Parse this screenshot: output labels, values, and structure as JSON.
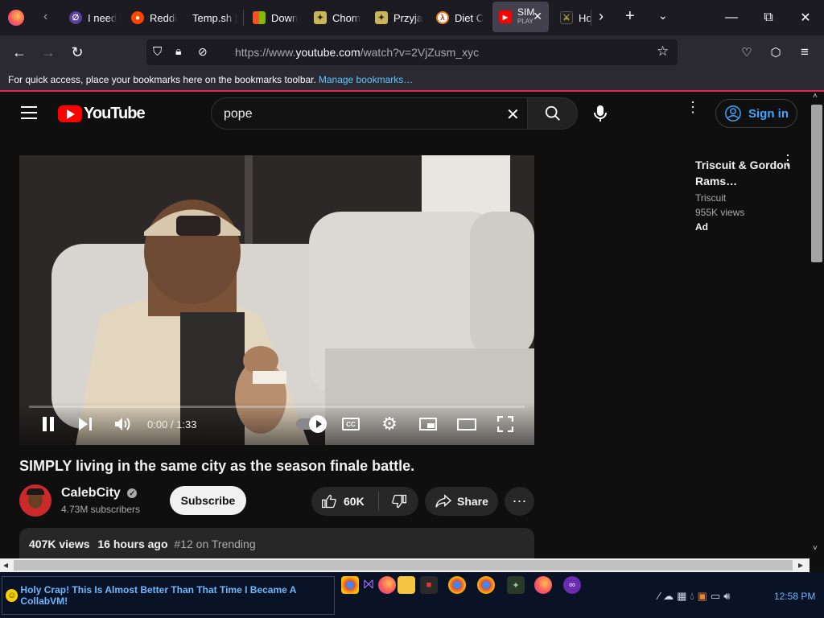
{
  "browser": {
    "tabs": [
      {
        "title": "I need"
      },
      {
        "title": "Reddi"
      },
      {
        "title": "Temp.sh |"
      },
      {
        "title": "Down"
      },
      {
        "title": "Chom"
      },
      {
        "title": "Przyja"
      },
      {
        "title": "Diet C"
      },
      {
        "title": "SIM",
        "subtitle": "PLAY",
        "active": true
      },
      {
        "title": "Ho"
      }
    ],
    "url_base": "https://www.",
    "url_host": "youtube.com",
    "url_path": "/watch?v=2VjZusm_xyc",
    "bookmarks_hint": "For quick access, place your bookmarks here on the bookmarks toolbar.",
    "bookmarks_link": "Manage bookmarks…"
  },
  "youtube": {
    "logo_text": "YouTube",
    "search_value": "pope",
    "sign_in": "Sign in"
  },
  "player": {
    "time": "0:00 / 1:33",
    "progress": 0
  },
  "video": {
    "title": "SIMPLY living in the same city as the season finale battle.",
    "channel": "CalebCity",
    "subscribers": "4.73M subscribers",
    "subscribe_label": "Subscribe",
    "likes": "60K",
    "share_label": "Share",
    "views": "407K views",
    "age": "16 hours ago",
    "trending": "#12 on Trending"
  },
  "ad": {
    "title": "Triscuit & Gordon Rams…",
    "advertiser": "Triscuit",
    "views": "955K views",
    "tag": "Ad"
  },
  "taskbar": {
    "message": "Holy Crap! This Is Almost Better Than That Time I Became A CollabVM!",
    "clock": "12:58 PM"
  },
  "colors": {
    "accent_link": "#3ea6ff",
    "yt_red": "#ff0000",
    "firefox_highlight": "#e22850"
  }
}
